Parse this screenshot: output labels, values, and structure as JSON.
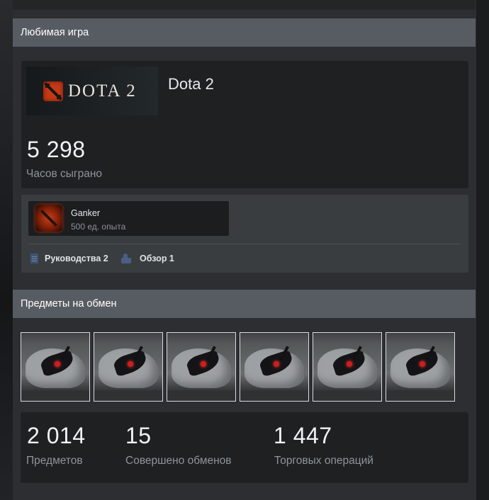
{
  "favorite_game": {
    "header": "Любимая игра",
    "logo_text": "DOTA 2",
    "game_name": "Dota 2",
    "hours_value": "5 298",
    "hours_label": "Часов сыграно",
    "badge": {
      "name": "Ganker",
      "xp": "500 ед. опыта"
    },
    "links": [
      {
        "label": "Руководства 2",
        "icon": "guide-icon"
      },
      {
        "label": "Обзор 1",
        "icon": "thumbs-up-icon"
      }
    ]
  },
  "trade": {
    "header": "Предметы на обмен",
    "item_count_shown": 6,
    "stats": [
      {
        "value": "2 014",
        "label": "Предметов"
      },
      {
        "value": "15",
        "label": "Совершено обменов"
      },
      {
        "value": "1 447",
        "label": "Торговых операций"
      }
    ]
  },
  "colors": {
    "header_bg": "#575c62",
    "card_bg": "#1f2022",
    "accent_red": "#c23a17"
  }
}
